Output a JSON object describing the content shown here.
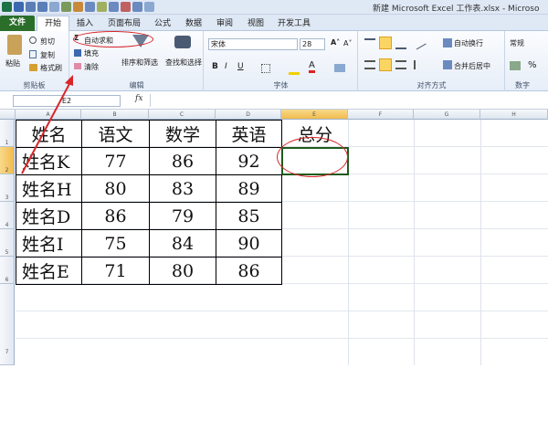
{
  "window": {
    "title": "新建 Microsoft Excel 工作表.xlsx - Microso"
  },
  "tabs": [
    "文件",
    "开始",
    "插入",
    "页面布局",
    "公式",
    "数据",
    "审阅",
    "视图",
    "开发工具"
  ],
  "ribbon": {
    "clipboard": {
      "paste": "粘贴",
      "cut": "剪切",
      "copy": "复制",
      "format_painter": "格式刷",
      "label": "剪贴板"
    },
    "editing": {
      "autosum": "自动求和",
      "fill": "填充",
      "clear": "清除",
      "sort_filter": "排序和筛选",
      "find_select": "查找和选择",
      "label": "编辑"
    },
    "font": {
      "name": "宋体",
      "size": "28",
      "label": "字体",
      "bold": "B",
      "italic": "I",
      "underline": "U"
    },
    "alignment": {
      "wrap": "自动换行",
      "merge": "合并后居中",
      "label": "对齐方式"
    },
    "number": {
      "format": "常规",
      "label": "数字"
    }
  },
  "formula_bar": {
    "name_box": "E2",
    "fx": "fx",
    "content": ""
  },
  "columns": [
    "A",
    "B",
    "C",
    "D",
    "E",
    "F",
    "G",
    "H"
  ],
  "rows": [
    "1",
    "2",
    "3",
    "4",
    "5",
    "6",
    "7"
  ],
  "table": {
    "header": [
      "姓名",
      "语文",
      "数学",
      "英语",
      "总分"
    ],
    "rows": [
      [
        "姓名K",
        "77",
        "86",
        "92",
        ""
      ],
      [
        "姓名H",
        "80",
        "83",
        "89",
        ""
      ],
      [
        "姓名D",
        "86",
        "79",
        "85",
        ""
      ],
      [
        "姓名I",
        "75",
        "84",
        "90",
        ""
      ],
      [
        "姓名E",
        "71",
        "80",
        "86",
        ""
      ]
    ]
  },
  "colors": {
    "accent_red": "#d8262a",
    "file_tab": "#2a6e2a",
    "selection": "#1f5a1f"
  },
  "icons": [
    "save-icon",
    "undo-icon",
    "redo-icon",
    "paste-icon",
    "scissors-icon",
    "copy-icon",
    "brush-icon",
    "sigma-icon",
    "fill-icon",
    "eraser-icon",
    "sort-filter-icon",
    "binoculars-icon",
    "arrow-annotation"
  ]
}
